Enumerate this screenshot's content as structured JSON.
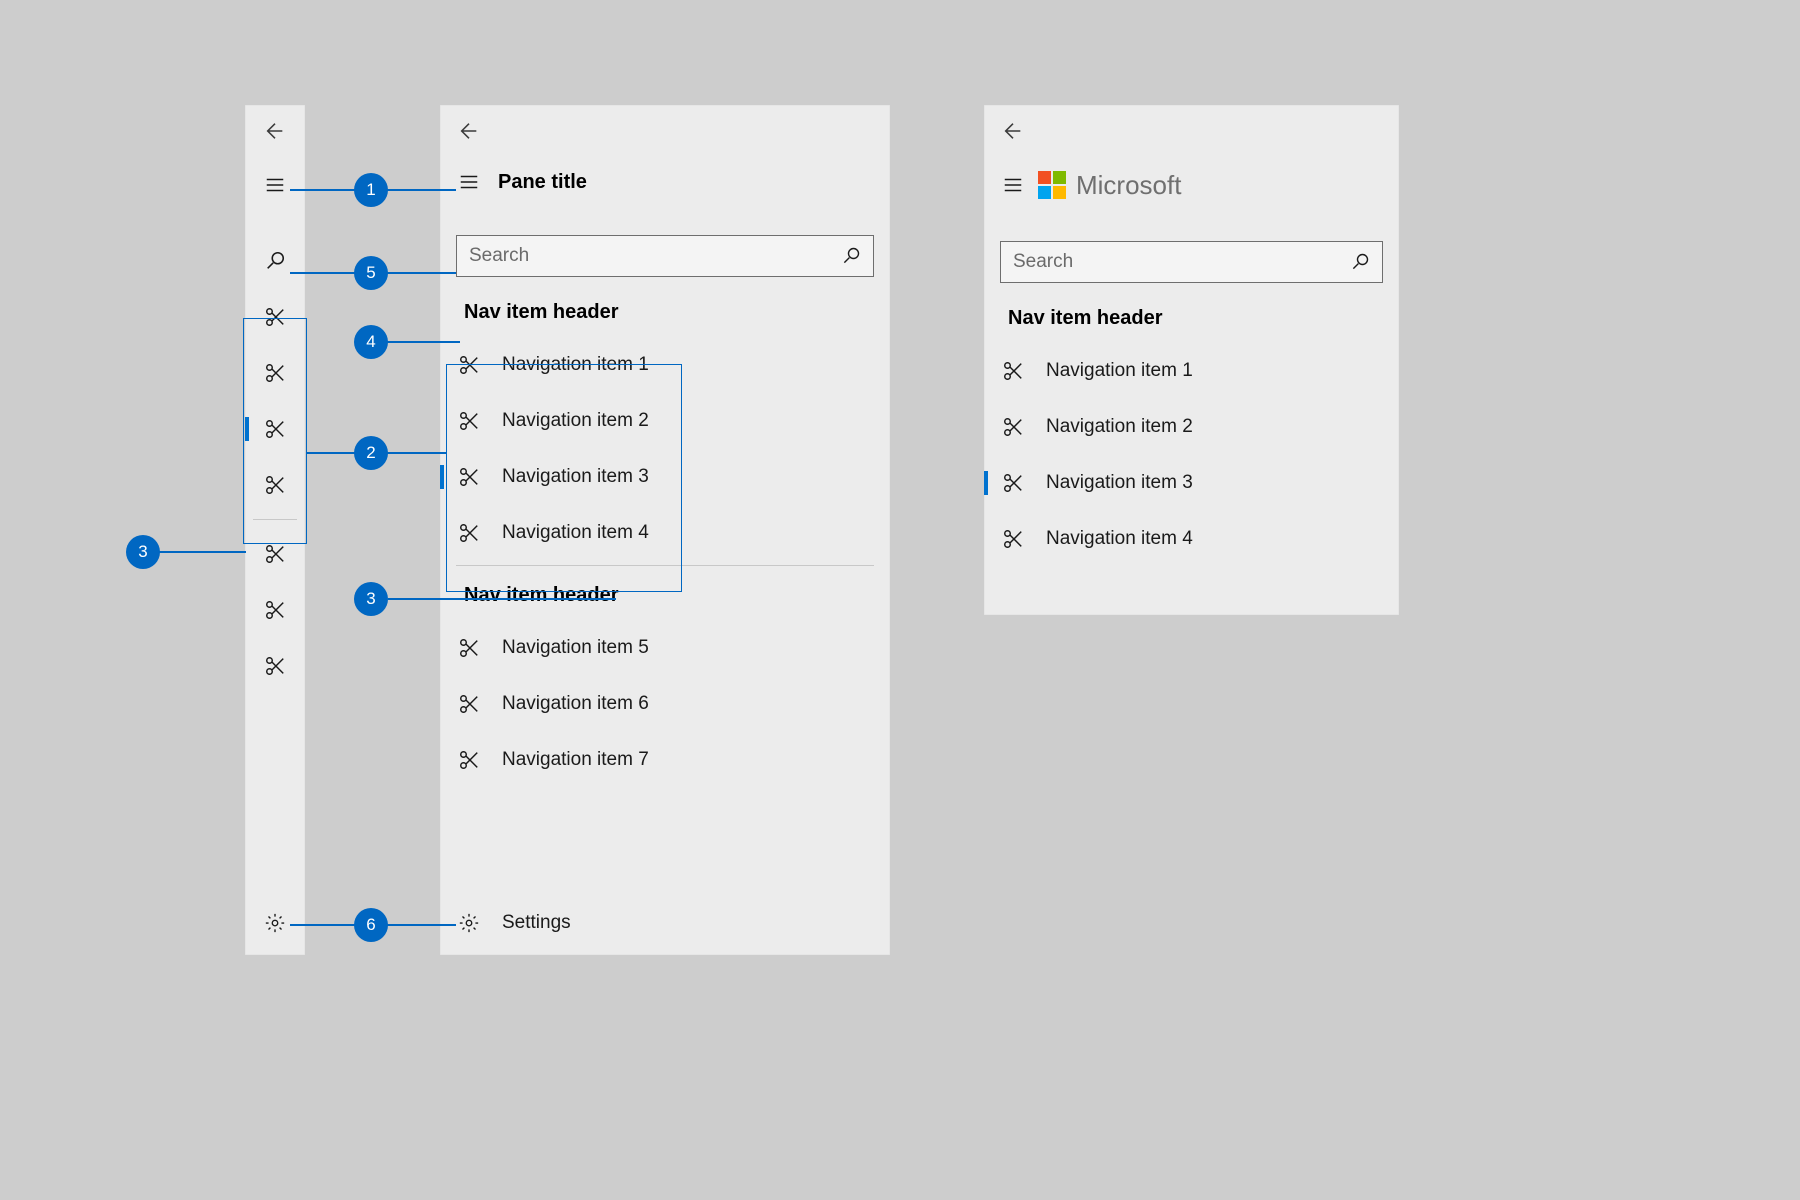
{
  "annotations": {
    "b1": "1",
    "b2": "2",
    "b3": "3",
    "b3b": "3",
    "b4": "4",
    "b5": "5",
    "b6": "6"
  },
  "compact": {
    "icons": [
      "back",
      "hamburger",
      "search",
      "item",
      "item",
      "item-selected",
      "item",
      "sep",
      "item",
      "item",
      "item",
      "spacer",
      "gear"
    ]
  },
  "expanded": {
    "pane_title": "Pane title",
    "search_placeholder": "Search",
    "group1_header": "Nav item header",
    "group1_items": [
      "Navigation item 1",
      "Navigation item 2",
      "Navigation item 3",
      "Navigation item 4"
    ],
    "group1_selected_index": 2,
    "group2_header": "Nav item header",
    "group2_items": [
      "Navigation item 5",
      "Navigation item 6",
      "Navigation item 7"
    ],
    "settings_label": "Settings"
  },
  "branded": {
    "brand_text": "Microsoft",
    "search_placeholder": "Search",
    "group_header": "Nav item header",
    "items": [
      "Navigation item 1",
      "Navigation item 2",
      "Navigation item 3",
      "Navigation item 4"
    ],
    "selected_index": 2
  }
}
